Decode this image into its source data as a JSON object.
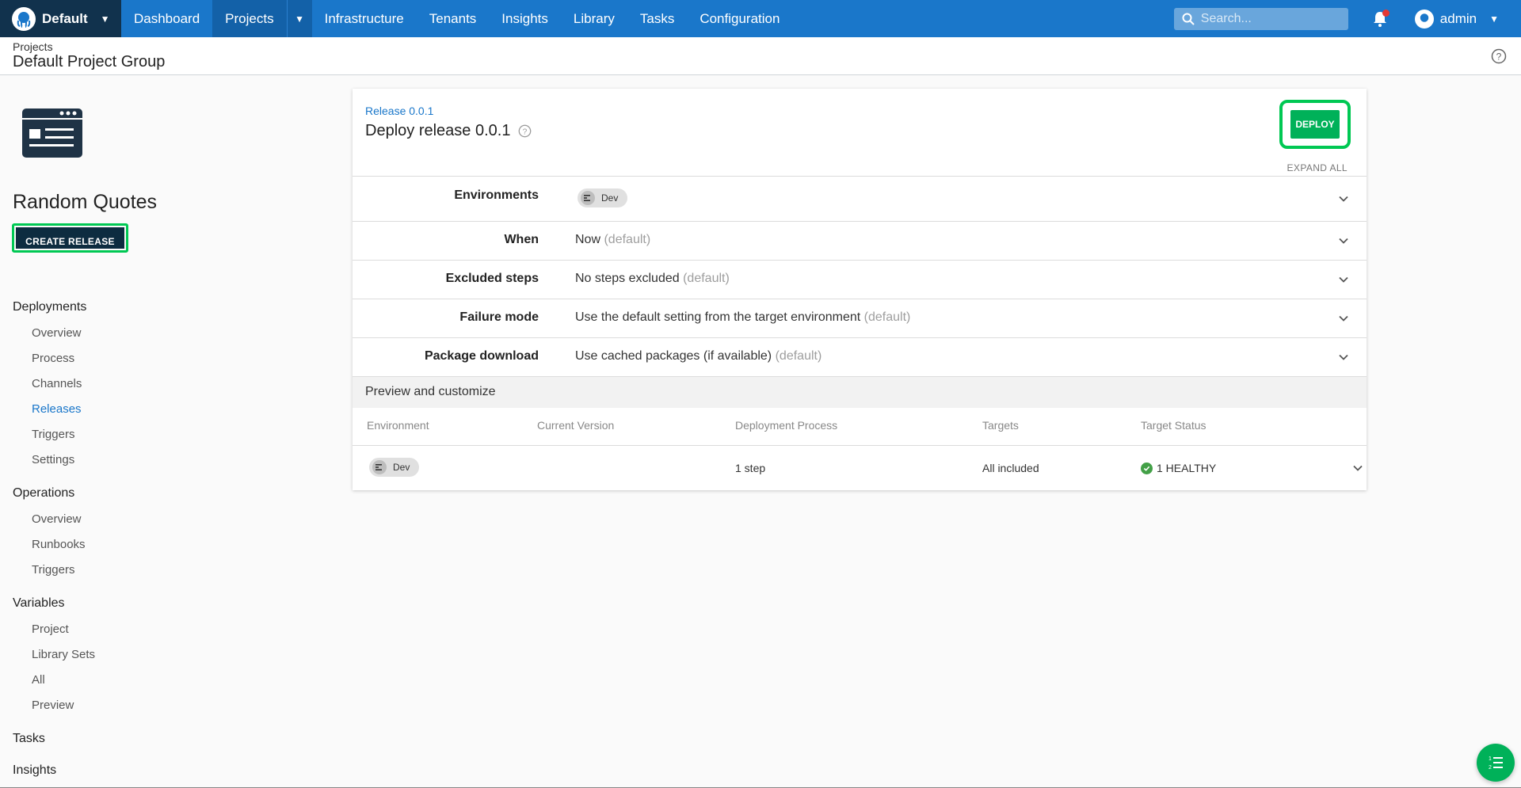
{
  "topnav": {
    "space": "Default",
    "items": [
      "Dashboard",
      "Projects",
      "Infrastructure",
      "Tenants",
      "Insights",
      "Library",
      "Tasks",
      "Configuration"
    ],
    "search_placeholder": "Search...",
    "user": "admin"
  },
  "header": {
    "breadcrumb": "Projects",
    "title": "Default Project Group"
  },
  "sidebar": {
    "project_name": "Random Quotes",
    "create_release": "CREATE RELEASE",
    "groups": [
      {
        "title": "Deployments",
        "links": [
          "Overview",
          "Process",
          "Channels",
          "Releases",
          "Triggers",
          "Settings"
        ]
      },
      {
        "title": "Operations",
        "links": [
          "Overview",
          "Runbooks",
          "Triggers"
        ]
      },
      {
        "title": "Variables",
        "links": [
          "Project",
          "Library Sets",
          "All",
          "Preview"
        ]
      },
      {
        "title": "Tasks",
        "links": []
      },
      {
        "title": "Insights",
        "links": []
      }
    ],
    "active_link": "Releases"
  },
  "card": {
    "release_link": "Release 0.0.1",
    "title": "Deploy release 0.0.1",
    "deploy": "DEPLOY",
    "expand_all": "EXPAND ALL",
    "rows": [
      {
        "label": "Environments",
        "value": "",
        "chip": "Dev"
      },
      {
        "label": "When",
        "value": "Now",
        "default": "(default)"
      },
      {
        "label": "Excluded steps",
        "value": "No steps excluded",
        "default": "(default)"
      },
      {
        "label": "Failure mode",
        "value": "Use the default setting from the target environment",
        "default": "(default)"
      },
      {
        "label": "Package download",
        "value": "Use cached packages (if available)",
        "default": "(default)"
      }
    ],
    "preview": {
      "title": "Preview and customize",
      "headers": [
        "Environment",
        "Current Version",
        "Deployment Process",
        "Targets",
        "Target Status"
      ],
      "row": {
        "environment": "Dev",
        "current_version": "",
        "process": "1 step",
        "targets": "All included",
        "status": "1 HEALTHY"
      }
    }
  },
  "colors": {
    "nav_blue": "#1a77ca",
    "space_dark": "#11324d",
    "deploy_green": "#00b159",
    "highlight_green": "#00c853",
    "create_dark": "#0d2c40"
  }
}
